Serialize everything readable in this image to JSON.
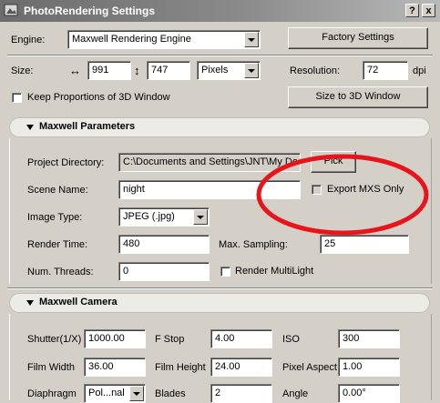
{
  "window": {
    "title": "PhotoRendering Settings"
  },
  "controls": {
    "help": "?",
    "close": "x"
  },
  "engine": {
    "label": "Engine:",
    "value": "Maxwell Rendering Engine",
    "factory_button": "Factory Settings"
  },
  "size": {
    "label": "Size:",
    "width_symbol": "↔",
    "width": "991",
    "height_symbol": "↕",
    "height": "747",
    "unit": "Pixels",
    "resolution_label": "Resolution:",
    "resolution": "72",
    "resolution_unit": "dpi"
  },
  "proportions": {
    "label": "Keep Proportions of 3D Window",
    "button": "Size to 3D Window"
  },
  "maxwell_params": {
    "header": "Maxwell Parameters",
    "project_dir_label": "Project Directory:",
    "project_dir": "C:\\Documents and Settings\\JNT\\My Documents",
    "pick_button": "Pick",
    "scene_name_label": "Scene Name:",
    "scene_name": "night",
    "export_mxs_label": "Export MXS Only",
    "image_type_label": "Image Type:",
    "image_type": "JPEG (.jpg)",
    "render_time_label": "Render Time:",
    "render_time": "480",
    "max_sampling_label": "Max. Sampling:",
    "max_sampling": "25",
    "threads_label": "Num. Threads:",
    "threads": "0",
    "multilight_label": "Render MultiLight"
  },
  "camera": {
    "header": "Maxwell Camera",
    "shutter_label": "Shutter(1/X)",
    "shutter": "1000.00",
    "fstop_label": "F Stop",
    "fstop": "4.00",
    "iso_label": "ISO",
    "iso": "300",
    "film_width_label": "Film Width",
    "film_width": "36.00",
    "film_height_label": "Film Height",
    "film_height": "24.00",
    "pixel_aspect_label": "Pixel Aspect",
    "pixel_aspect": "1.00",
    "diaphragm_label": "Diaphragm",
    "diaphragm": "Pol...nal",
    "blades_label": "Blades",
    "blades": "2",
    "angle_label": "Angle",
    "angle": "0.00°"
  },
  "annotation": {
    "color": "#e8141c"
  }
}
